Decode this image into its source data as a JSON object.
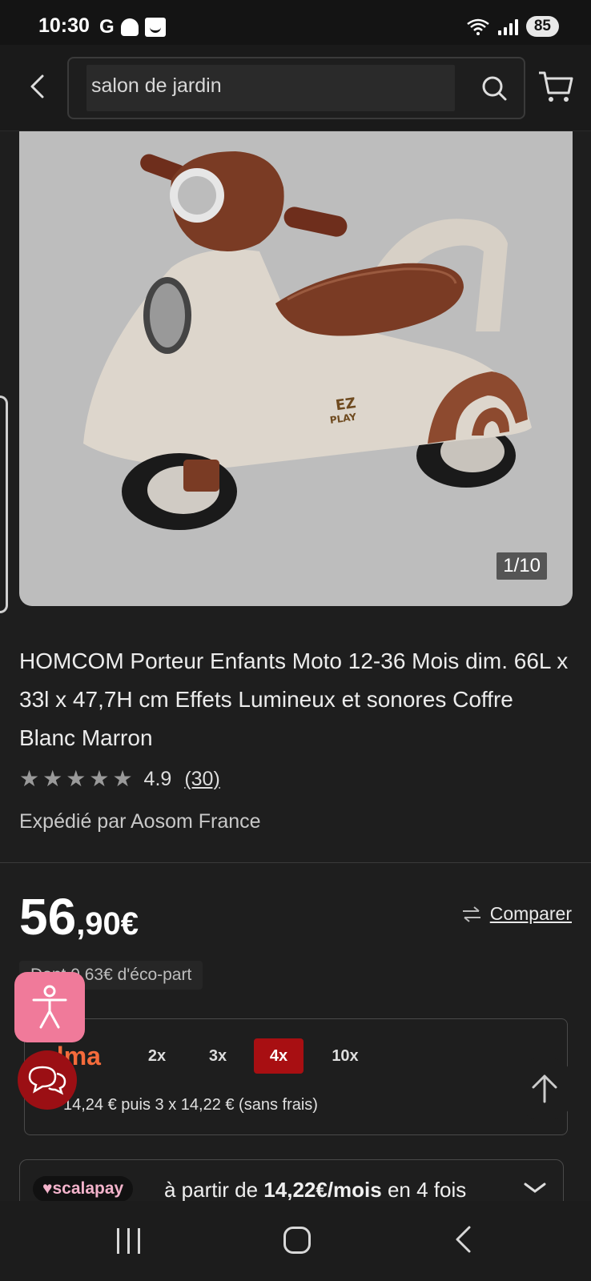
{
  "status_bar": {
    "time": "10:30",
    "carrier_icon": "G",
    "battery": "85"
  },
  "nav": {
    "search_value": "salon de jardin",
    "icons": [
      "back-arrow-icon",
      "search-icon",
      "cart-icon"
    ]
  },
  "gallery": {
    "counter": "1/10"
  },
  "product": {
    "title": "HOMCOM Porteur Enfants Moto 12-36 Mois dim. 66L x 33l x 47,7H cm Effets Lumineux et sonores Coffre Blanc Marron",
    "rating": "4.9",
    "rating_stars": 4.9,
    "review_count": "(30)",
    "seller": "Expédié par Aosom France"
  },
  "price": {
    "integer": "56",
    "decimal": ",90€",
    "compare_label": "Comparer",
    "eco_part": "Dont 0,63€ d'éco-part"
  },
  "alma": {
    "logo": "alma",
    "options": [
      "2x",
      "3x",
      "4x",
      "10x"
    ],
    "selected": "4x",
    "detail": "14,24 € puis 3 x 14,22 € (sans frais)"
  },
  "scalapay": {
    "logo": "♥scalapay",
    "text_prefix": "à partir de ",
    "amount": "14,22€/mois",
    "text_suffix": " en 4 fois"
  },
  "colors": {
    "background": "#1e1e1e",
    "alma_accent": "#f56b3b",
    "selected_option": "#a80f12",
    "accessibility_button": "#f07a9a",
    "chat_button": "#9b0f14"
  }
}
